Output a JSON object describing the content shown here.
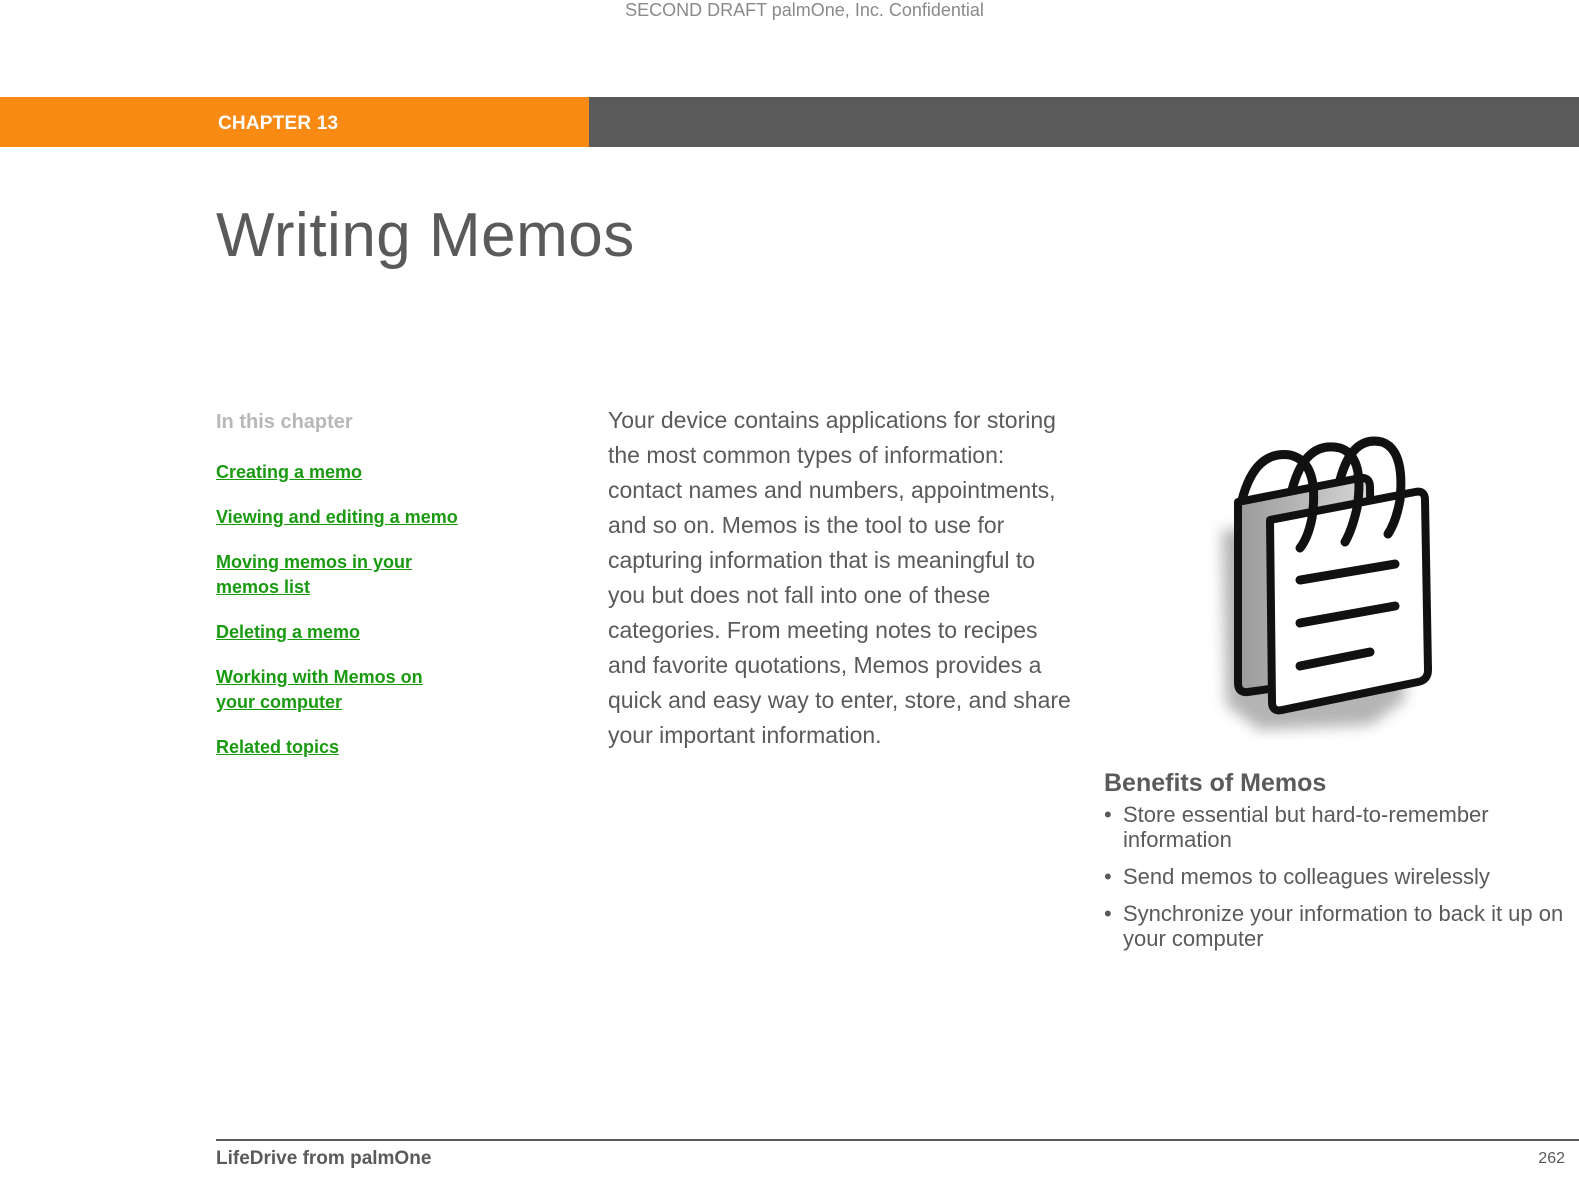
{
  "watermark": "SECOND DRAFT palmOne, Inc.  Confidential",
  "header": {
    "chapter_label": "CHAPTER 13",
    "accent_color": "#f98a13",
    "bar_color": "#5a5a5a"
  },
  "page_title": "Writing Memos",
  "toc": {
    "heading": "In this chapter",
    "link_color": "#1a9a10",
    "links": [
      {
        "label": "Creating a memo"
      },
      {
        "label": "Viewing and editing a memo"
      },
      {
        "label": "Moving memos in your memos list"
      },
      {
        "label": "Deleting a memo"
      },
      {
        "label": "Working with Memos on your computer"
      },
      {
        "label": "Related topics"
      }
    ]
  },
  "intro_text": "Your device contains applications for storing the most common types of information: contact names and numbers, appointments, and so on. Memos is the tool to use for capturing information that is meaningful to you but does not fall into one of these categories. From meeting notes to recipes and favorite quotations, Memos provides a quick and easy way to enter, store, and share your important information.",
  "illustration": {
    "icon": "notepad-icon"
  },
  "benefits": {
    "heading": "Benefits of Memos",
    "bullet": "•",
    "items": [
      "Store essential but hard-to-remember information",
      "Send memos to colleagues wirelessly",
      "Synchronize your information to back it up on your computer"
    ]
  },
  "footer": {
    "product": "LifeDrive from palmOne",
    "page_number": "262"
  }
}
